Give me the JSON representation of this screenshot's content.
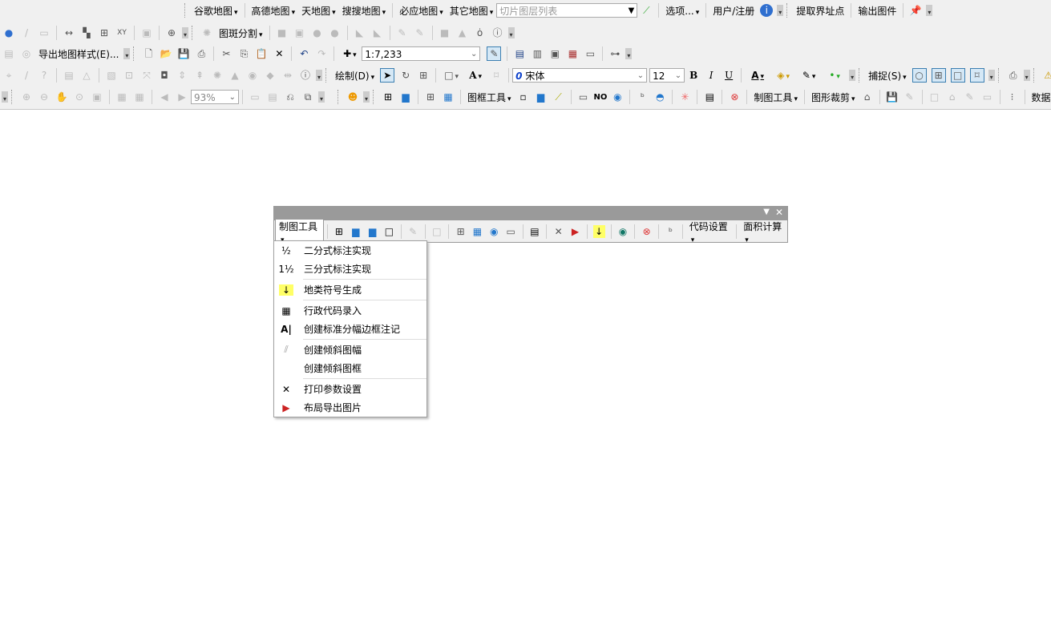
{
  "toolbar1": {
    "items": [
      "谷歌地图",
      "高德地图",
      "天地图",
      "搜搜地图",
      "必应地图",
      "其它地图"
    ],
    "tile_placeholder": "切片图层列表",
    "options": "选项...",
    "user": "用户/注册",
    "extract": "提取界址点",
    "export_map": "输出图件"
  },
  "toolbar2": {
    "split": "图斑分割"
  },
  "toolbar3": {
    "export_style": "导出地图样式(E)...",
    "scale": "1:7,233"
  },
  "toolbar4": {
    "draw": "绘制(D)",
    "font": "宋体",
    "font_size": "12",
    "bold": "B",
    "italic": "I",
    "underline": "U",
    "snap": "捕捉(S)"
  },
  "toolbar5": {
    "zoom": "93%",
    "frame_tools": "图框工具",
    "no": "NO",
    "map_tools": "制图工具",
    "clip": "图形裁剪",
    "data_proc": "数据处理"
  },
  "floating": {
    "map_tools": "制图工具",
    "code_settings": "代码设置",
    "area_calc": "面积计算"
  },
  "menu": {
    "items": [
      {
        "icon": "fraction-icon",
        "glyph": "½",
        "label": "二分式标注实现"
      },
      {
        "icon": "mixed-fraction-icon",
        "glyph": "1½",
        "label": "三分式标注实现"
      },
      {
        "icon": "down-arrow-icon",
        "glyph": "↓",
        "label": "地类符号生成"
      },
      {
        "icon": "table-icon",
        "glyph": "▦",
        "label": "行政代码录入"
      },
      {
        "icon": "text-icon",
        "glyph": "A|",
        "label": "创建标准分幅边框注记"
      },
      {
        "icon": "slash-icon",
        "glyph": "⫽",
        "label": "创建倾斜图幅"
      },
      {
        "icon": "",
        "glyph": "",
        "label": "创建倾斜图框"
      },
      {
        "icon": "print-settings-icon",
        "glyph": "✕",
        "label": "打印参数设置"
      },
      {
        "icon": "export-image-icon",
        "glyph": "▶",
        "label": "布局导出图片"
      }
    ]
  },
  "colors": {
    "accent": "#3c7fb1",
    "title_bar": "#9a9a9a"
  }
}
